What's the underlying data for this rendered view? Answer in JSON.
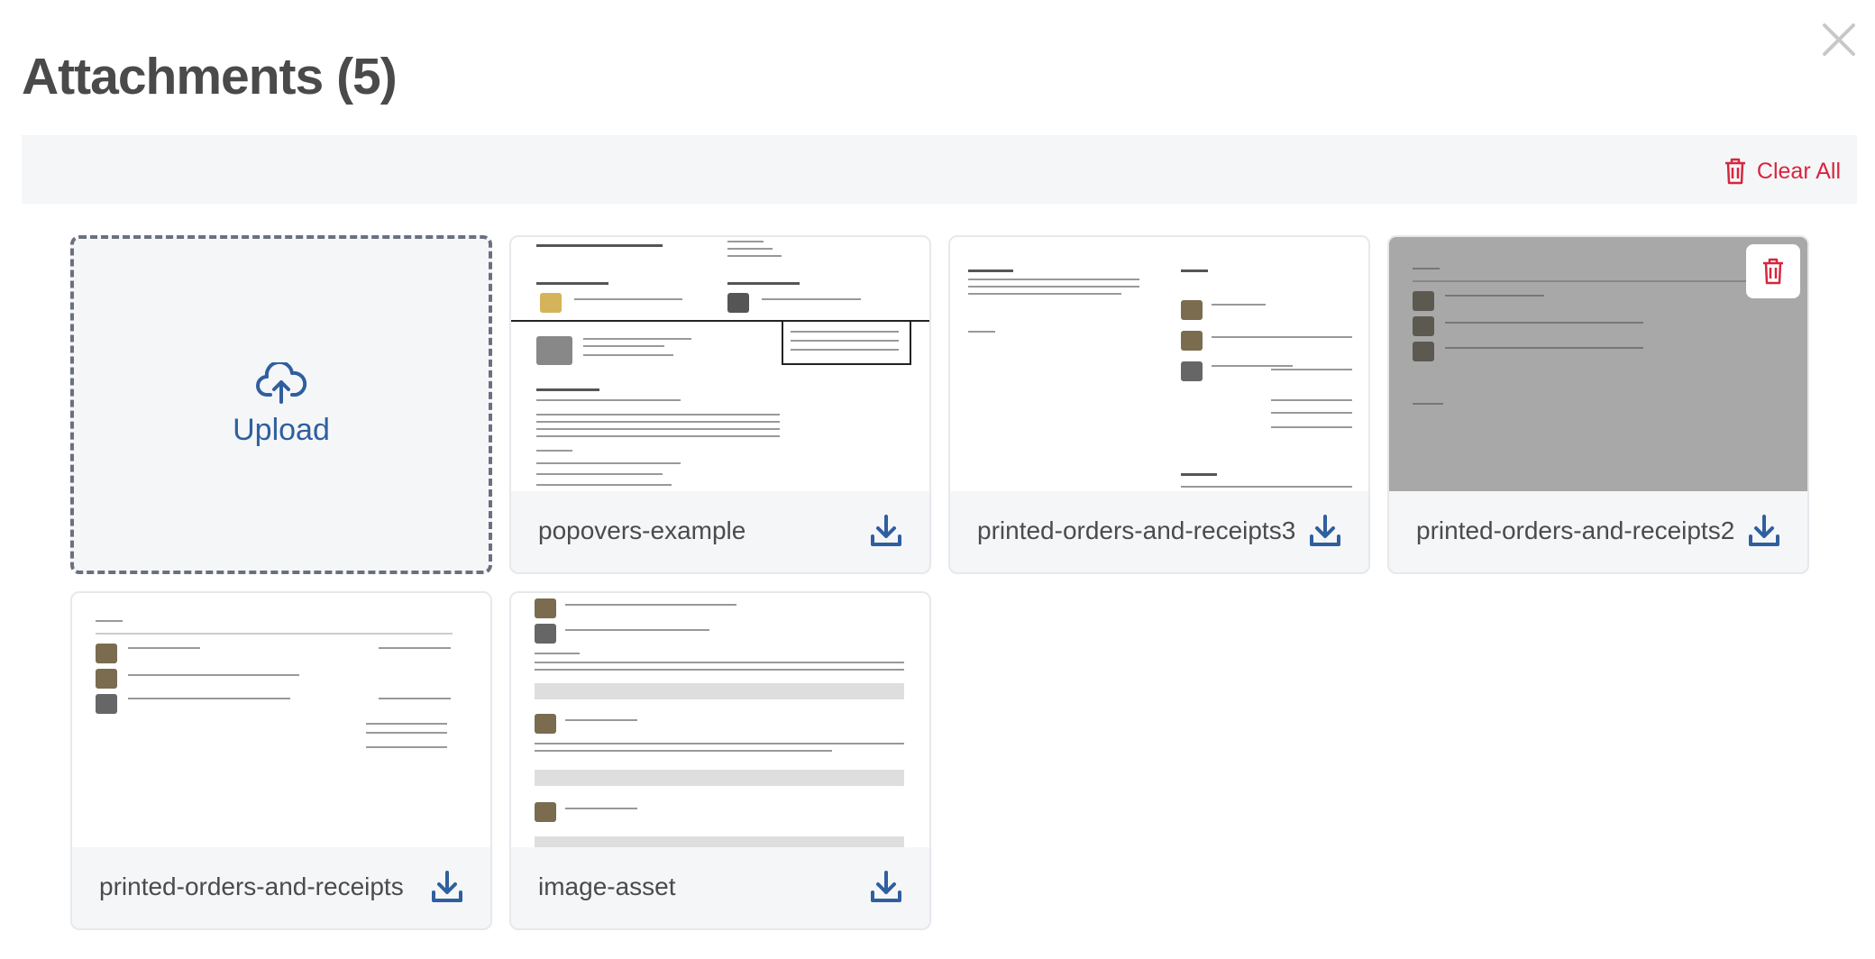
{
  "dialog": {
    "title": "Attachments (5)",
    "toolbar": {
      "clear_all_label": "Clear All"
    },
    "upload": {
      "label": "Upload"
    },
    "files": [
      {
        "name": "popovers-example"
      },
      {
        "name": "printed-orders-and-receipts3"
      },
      {
        "name": "printed-orders-and-receipts2"
      },
      {
        "name": "printed-orders-and-receipts"
      },
      {
        "name": "image-asset"
      }
    ]
  },
  "icons": {
    "close": "close-icon",
    "trash": "trash-icon",
    "upload": "cloud-upload-icon",
    "download": "download-icon"
  },
  "colors": {
    "accent_blue": "#2f5f9e",
    "danger_red": "#d7263d",
    "toolbar_bg": "#f5f6f8"
  }
}
